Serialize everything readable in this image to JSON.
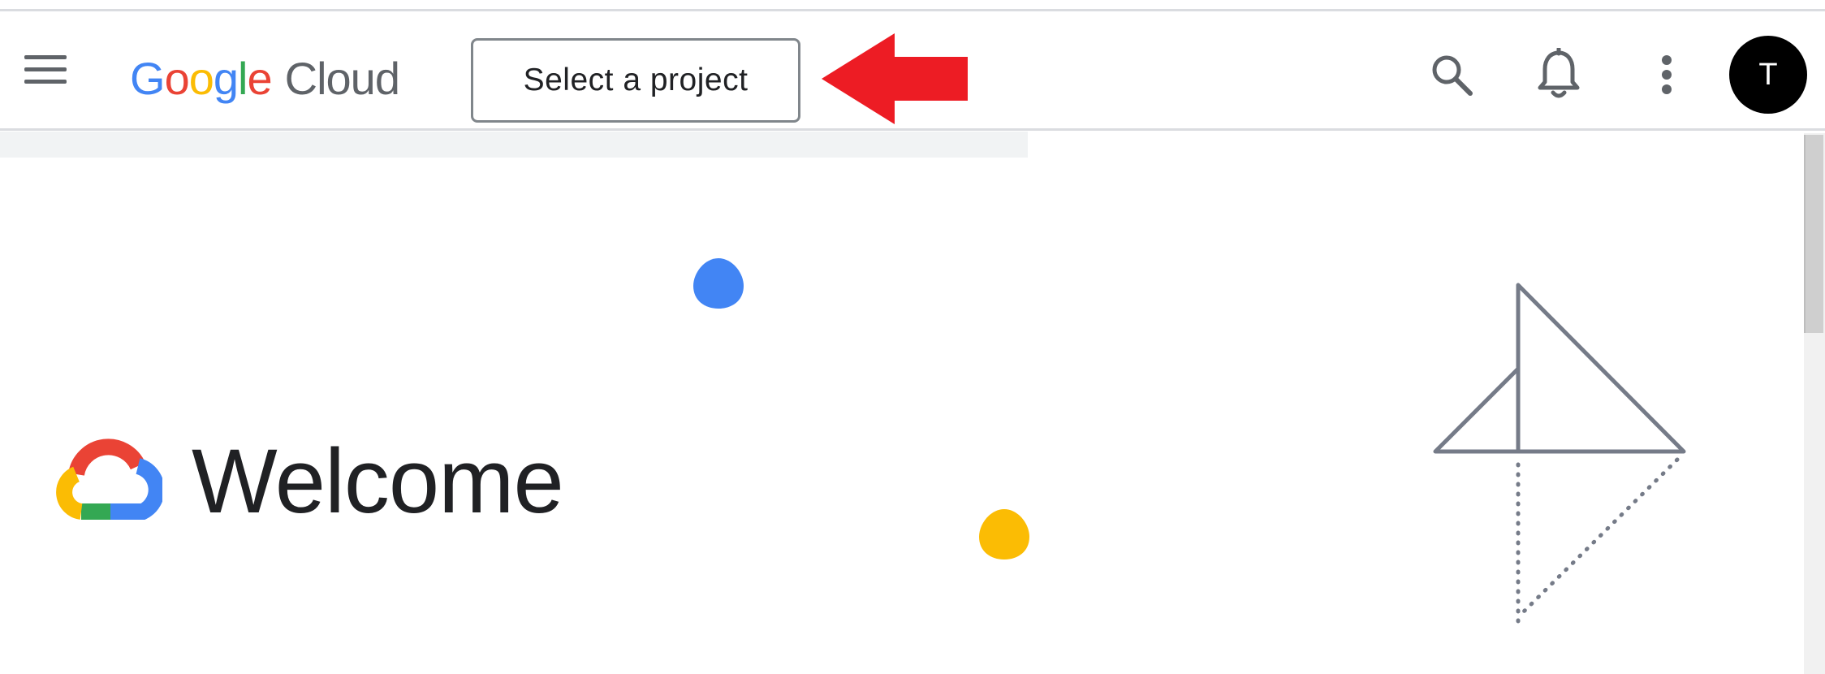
{
  "header": {
    "menu_label": "Main menu",
    "logo_word_google": [
      "G",
      "o",
      "o",
      "g",
      "l",
      "e"
    ],
    "logo_word_cloud": "Cloud",
    "project_button_label": "Select a project",
    "avatar_initial": "T"
  },
  "main": {
    "welcome_title": "Welcome"
  },
  "icons": {
    "menu": "hamburger-menu-icon",
    "search": "search-icon",
    "notifications": "bell-icon",
    "more": "more-vert-icon",
    "annotation": "red-arrow-pointer",
    "logo": "google-cloud-logo-icon"
  },
  "colors": {
    "google_blue": "#4285f4",
    "google_red": "#ea4335",
    "google_yellow": "#fbbc04",
    "google_green": "#34a853",
    "icon_gray": "#5f6368",
    "annotation_red": "#ed1c24",
    "text_dark": "#202124"
  }
}
